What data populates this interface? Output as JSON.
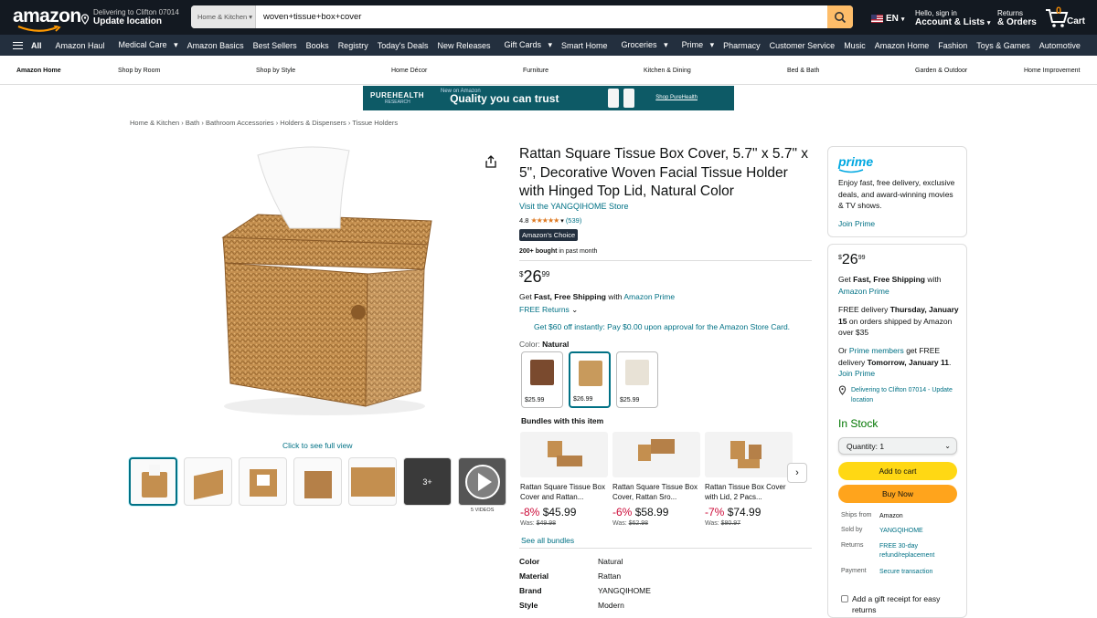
{
  "header": {
    "logo": "amazon",
    "deliver_line1": "Delivering to Clifton 07014",
    "deliver_line2": "Update location",
    "search_category": "Home & Kitchen",
    "search_value": "woven+tissue+box+cover",
    "lang": "EN",
    "account_line1": "Hello, sign in",
    "account_line2": "Account & Lists",
    "returns_line1": "Returns",
    "returns_line2": "& Orders",
    "cart_count": "0",
    "cart_label": "Cart"
  },
  "nav_main": [
    "All",
    "Amazon Haul",
    "Medical Care",
    "Amazon Basics",
    "Best Sellers",
    "Books",
    "Registry",
    "Today's Deals",
    "New Releases",
    "Gift Cards",
    "Smart Home",
    "Groceries",
    "Prime",
    "Pharmacy",
    "Customer Service",
    "Music",
    "Amazon Home",
    "Fashion",
    "Toys & Games",
    "Automotive"
  ],
  "nav_sub": [
    "Amazon Home",
    "Shop by Room",
    "Shop by Style",
    "Home Décor",
    "Furniture",
    "Kitchen & Dining",
    "Bed & Bath",
    "Garden & Outdoor",
    "Home Improvement"
  ],
  "banner": {
    "brand": "PUREHEALTH",
    "brand_sub": "RESEARCH",
    "tag": "New on Amazon",
    "headline": "Quality you can trust",
    "cta": "Shop PureHealth"
  },
  "breadcrumb": [
    "Home & Kitchen",
    "Bath",
    "Bathroom Accessories",
    "Holders & Dispensers",
    "Tissue Holders"
  ],
  "gallery": {
    "click_text": "Click to see full view",
    "more_count": "3+",
    "videos_label": "5 VIDEOS"
  },
  "product": {
    "title": "Rattan Square Tissue Box Cover, 5.7\" x 5.7\" x 5\", Decorative Woven Facial Tissue Holder with Hinged Top Lid, Natural Color",
    "store": "Visit the YANGQIHOME Store",
    "rating": "4.8",
    "reviews": "(539)",
    "choice_badge": "Amazon's Choice",
    "bought_bold": "200+ bought",
    "bought_rest": "in past month",
    "price_symbol": "$",
    "price_whole": "26",
    "price_frac": "99",
    "ship_pre": "Get",
    "ship_bold": "Fast, Free Shipping",
    "ship_mid": "with",
    "ship_link": "Amazon Prime",
    "returns": "FREE Returns",
    "store_card": "Get $60 off instantly: Pay $0.00 upon approval for the Amazon Store Card.",
    "color_label": "Color:",
    "color_value": "Natural",
    "swatches": [
      {
        "price": "$25.99",
        "color": "#7a4a2e"
      },
      {
        "price": "$26.99",
        "color": "#c89a5c"
      },
      {
        "price": "$25.99",
        "color": "#e8e2d6"
      }
    ],
    "bundles_heading": "Bundles with this item",
    "bundles": [
      {
        "name": "Rattan Square Tissue Box Cover and Rattan...",
        "pct": "-8%",
        "price": "$45.99",
        "was_label": "Was:",
        "was": "$49.98"
      },
      {
        "name": "Rattan Square Tissue Box Cover, Rattan Sro...",
        "pct": "-6%",
        "price": "$58.99",
        "was_label": "Was:",
        "was": "$62.98"
      },
      {
        "name": "Rattan Tissue Box Cover with Lid, 2 Pacs...",
        "pct": "-7%",
        "price": "$74.99",
        "was_label": "Was:",
        "was": "$80.97"
      }
    ],
    "see_all": "See all bundles",
    "specs": [
      {
        "k": "Color",
        "v": "Natural"
      },
      {
        "k": "Material",
        "v": "Rattan"
      },
      {
        "k": "Brand",
        "v": "YANGQIHOME"
      },
      {
        "k": "Style",
        "v": "Modern"
      }
    ]
  },
  "prime_box": {
    "logo": "prime",
    "text": "Enjoy fast, free delivery, exclusive deals, and award-winning movies & TV shows.",
    "join": "Join Prime"
  },
  "buy_box": {
    "price_symbol": "$",
    "price_whole": "26",
    "price_frac": "99",
    "ship_pre": "Get",
    "ship_bold": "Fast, Free Shipping",
    "ship_mid": "with",
    "ship_link": "Amazon Prime",
    "free_pre": "FREE delivery",
    "free_date": "Thursday, January 15",
    "free_post": "on orders shipped by Amazon over $35",
    "or_pre": "Or",
    "or_link": "Prime members",
    "or_mid": "get FREE delivery",
    "or_date": "Tomorrow, January 11",
    "or_post": ".",
    "join": "Join Prime",
    "location": "Delivering to Clifton 07014 - Update location",
    "stock": "In Stock",
    "qty_label": "Quantity:",
    "qty_value": "1",
    "add_to_cart": "Add to cart",
    "buy_now": "Buy Now",
    "meta": [
      {
        "k": "Ships from",
        "v": "Amazon"
      },
      {
        "k": "Sold by",
        "v": "YANGQIHOME"
      },
      {
        "k": "Returns",
        "v": "FREE 30-day refund/replacement"
      },
      {
        "k": "Payment",
        "v": "Secure transaction"
      }
    ],
    "gift": "Add a gift receipt for easy returns"
  }
}
